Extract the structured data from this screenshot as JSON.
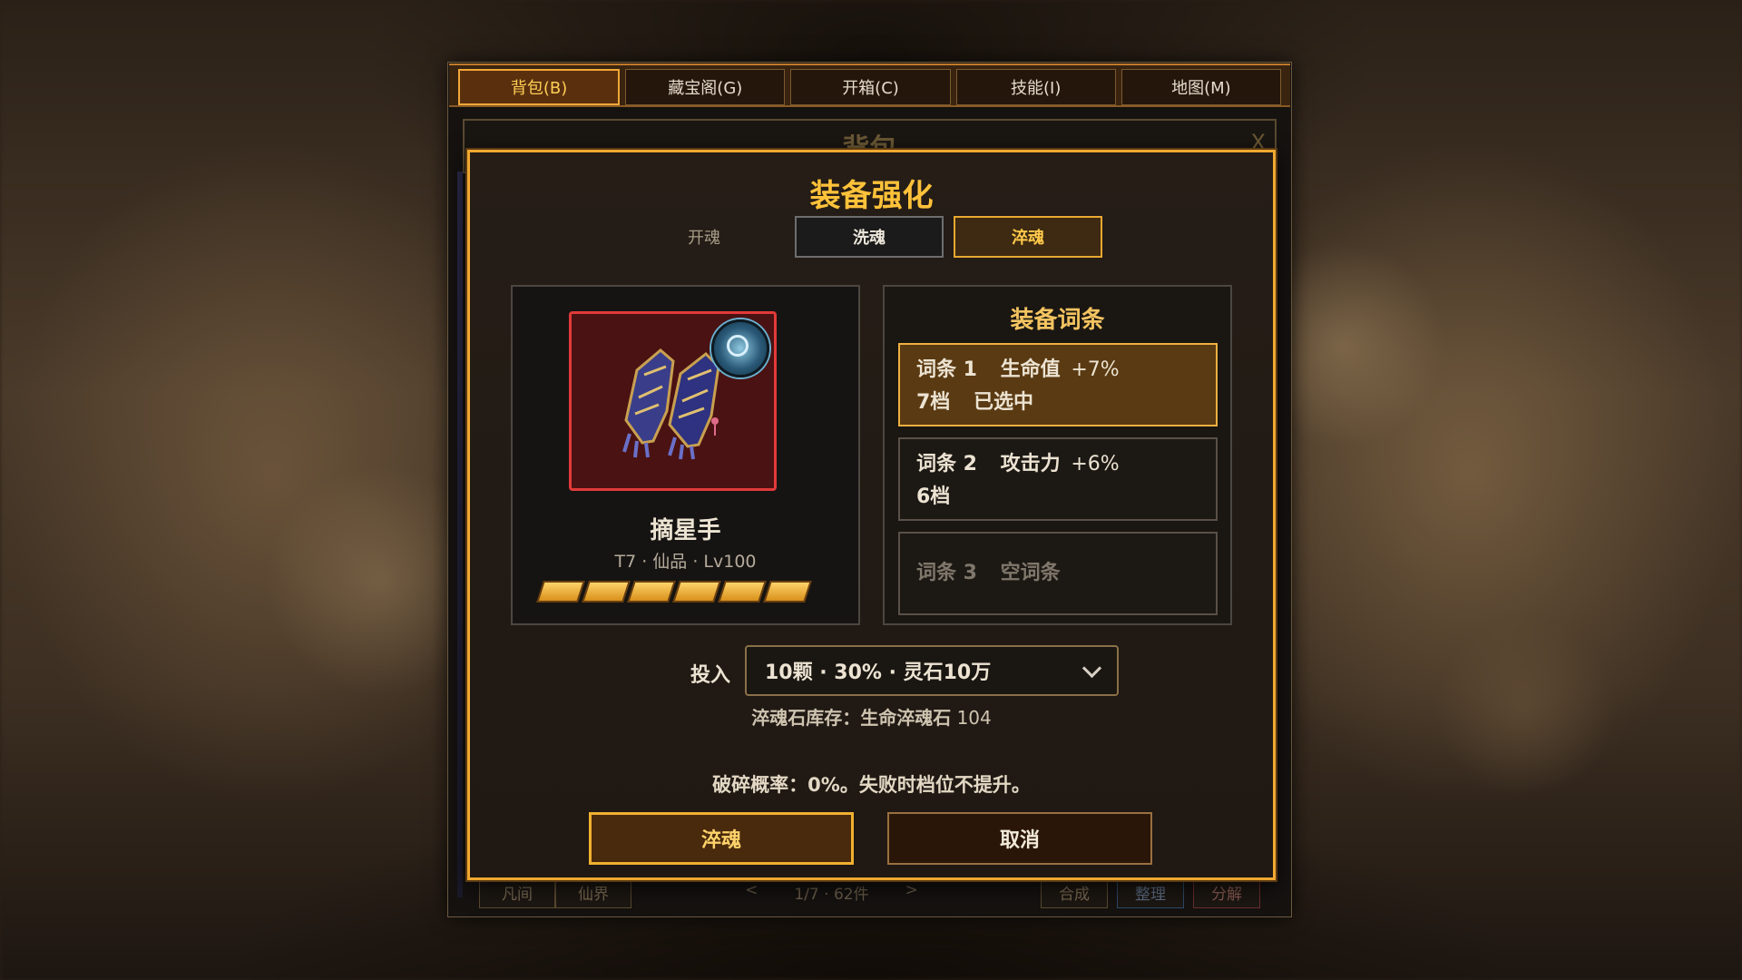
{
  "tabs": [
    {
      "label": "背包(B)",
      "active": true
    },
    {
      "label": "藏宝阁(G)"
    },
    {
      "label": "开箱(C)"
    },
    {
      "label": "技能(I)"
    },
    {
      "label": "地图(M)"
    }
  ],
  "backdrop_panel": {
    "title": "背包",
    "close": "X",
    "footer": {
      "tab_mortal": "凡间",
      "tab_immortal": "仙界",
      "prev": "<",
      "page_info": "1/7 · 62件",
      "next": ">",
      "merge": "合成",
      "sort": "整理",
      "decompose": "分解"
    }
  },
  "modal": {
    "title": "装备强化",
    "modes": {
      "open_soul": "开魂",
      "wash_soul": "洗魂",
      "temper_soul": "淬魂",
      "active": "淬魂"
    },
    "item": {
      "name": "摘星手",
      "meta": "T7 · 仙品 · Lv100",
      "star_segments": 6,
      "icon": "gauntlet-icon",
      "badge_icon": "soul-orb-icon"
    },
    "affix_section": {
      "title": "装备词条",
      "affixes": [
        {
          "slot": "词条 1",
          "stat": "生命值",
          "value": "+7%",
          "tier": "7档",
          "status": "已选中",
          "selected": true
        },
        {
          "slot": "词条 2",
          "stat": "攻击力",
          "value": "+6%",
          "tier": "6档"
        },
        {
          "slot": "词条 3",
          "stat": "空词条"
        }
      ]
    },
    "input": {
      "label": "投入",
      "selected": "10颗 · 30% · 灵石10万"
    },
    "stock": {
      "label": "淬魂石库存：",
      "item": "生命淬魂石",
      "count": "104"
    },
    "break_rate": "破碎概率：0%。失败时档位不提升。",
    "confirm_label": "淬魂",
    "cancel_label": "取消"
  },
  "colors": {
    "accent_gold": "#f0a830",
    "title_gold": "#ffc23a",
    "item_frame_red": "#e23a3a"
  }
}
